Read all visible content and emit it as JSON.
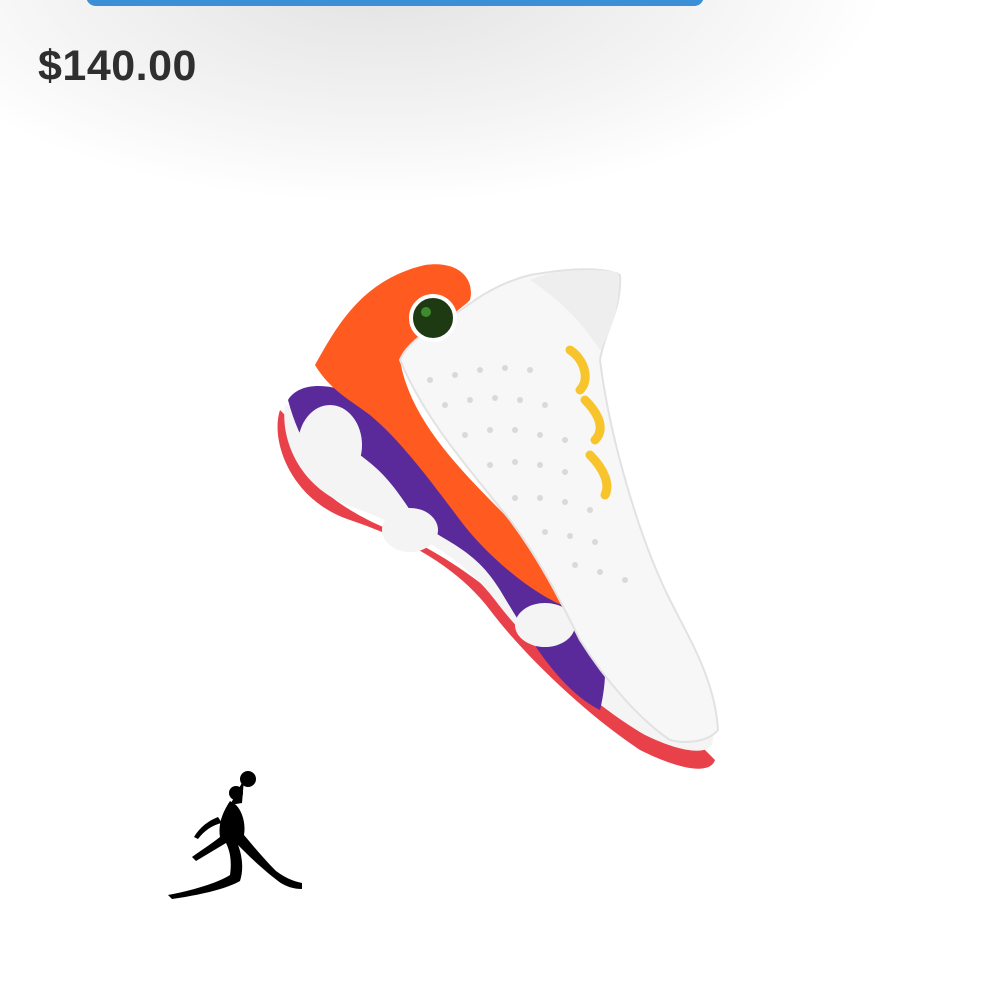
{
  "product": {
    "price": "$140.00",
    "image_icon": "sneaker-product-image",
    "logo_icon": "jumpman-logo-icon"
  },
  "colors": {
    "accent_blue": "#3a8fd6",
    "price_text": "#2f2f2f",
    "shoe_orange": "#ff5a1f",
    "shoe_purple": "#5b2a9a",
    "shoe_yellow": "#f7c52b",
    "sole_red": "#e8414a"
  }
}
